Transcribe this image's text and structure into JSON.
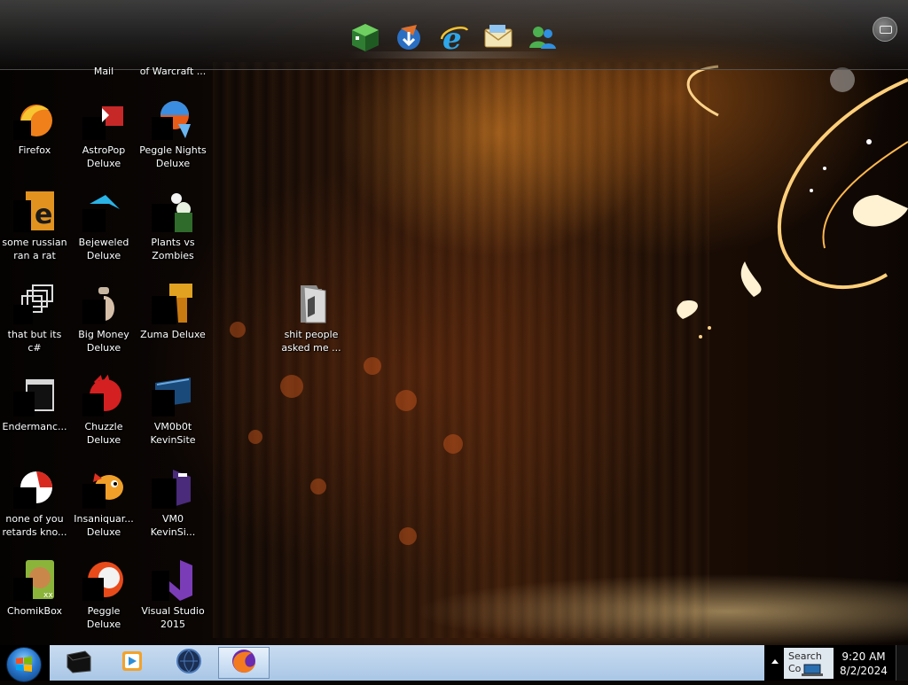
{
  "dock": {
    "items": [
      {
        "name": "Minecraft",
        "icon": "minecraft-cube-icon"
      },
      {
        "name": "Downloader",
        "icon": "download-globe-icon"
      },
      {
        "name": "Internet Explorer",
        "icon": "internet-explorer-icon"
      },
      {
        "name": "Mail",
        "icon": "mail-envelope-icon"
      },
      {
        "name": "Messenger",
        "icon": "messenger-people-icon"
      }
    ],
    "settings_icon": "briefcase-settings-icon"
  },
  "top_row_labels": [
    {
      "text": "Mail"
    },
    {
      "text": "of Warcraft ..."
    }
  ],
  "desktop_icons": [
    {
      "label_1": "Firefox",
      "label_2": "",
      "icon": "firefox-icon"
    },
    {
      "label_1": "AstroPop",
      "label_2": "Deluxe",
      "icon": "astropop-icon"
    },
    {
      "label_1": "Peggle Nights",
      "label_2": "Deluxe",
      "icon": "peggle-nights-icon"
    },
    {
      "label_1": "some russian",
      "label_2": "ran a rat",
      "icon": "executable-icon"
    },
    {
      "label_1": "Bejeweled",
      "label_2": "Deluxe",
      "icon": "bejeweled-icon"
    },
    {
      "label_1": "Plants vs",
      "label_2": "Zombies",
      "icon": "plants-vs-zombies-icon"
    },
    {
      "label_1": "that but its c#",
      "label_2": "",
      "icon": "windows-stack-icon"
    },
    {
      "label_1": "Big Money",
      "label_2": "Deluxe",
      "icon": "big-money-icon"
    },
    {
      "label_1": "Zuma Deluxe",
      "label_2": "",
      "icon": "zuma-icon"
    },
    {
      "label_1": "shit people",
      "label_2": "asked me ...",
      "icon": "folder-icon"
    },
    {
      "label_1": "Endermanc...",
      "label_2": "",
      "icon": "terminal-window-icon"
    },
    {
      "label_1": "Chuzzle",
      "label_2": "Deluxe",
      "icon": "chuzzle-icon"
    },
    {
      "label_1": "VM0b0t",
      "label_2": "KevinSite",
      "icon": "vm-folder-icon"
    },
    {
      "label_1": "none of you",
      "label_2": "retards kno...",
      "icon": "chrome-icon"
    },
    {
      "label_1": "Insaniquar...",
      "label_2": "Deluxe",
      "icon": "insaniquarium-icon"
    },
    {
      "label_1": "VM0",
      "label_2": "KevinSi...",
      "icon": "visual-studio-file-icon"
    },
    {
      "label_1": "ChomikBox",
      "label_2": "",
      "icon": "chomikbox-icon"
    },
    {
      "label_1": "Peggle Deluxe",
      "label_2": "",
      "icon": "peggle-icon"
    },
    {
      "label_1": "Visual Studio",
      "label_2": "2015",
      "icon": "visual-studio-icon"
    }
  ],
  "taskbar": {
    "start_icon": "windows-start-orb-icon",
    "buttons": [
      {
        "name": "Command Prompt",
        "icon": "terminal-icon",
        "active": false
      },
      {
        "name": "Media Player",
        "icon": "media-player-icon",
        "active": false
      },
      {
        "name": "Blue Orb App",
        "icon": "globe-dark-icon",
        "active": false
      },
      {
        "name": "Firefox",
        "icon": "firefox-icon",
        "active": true
      }
    ],
    "tray": {
      "search_text": "Search Co",
      "time": "9:20 AM",
      "date": "8/2/2024"
    }
  },
  "colors": {
    "taskbar": "#b8d1ec",
    "wallpaper_accent": "#e08a2a",
    "icon_label": "#ffffff"
  }
}
